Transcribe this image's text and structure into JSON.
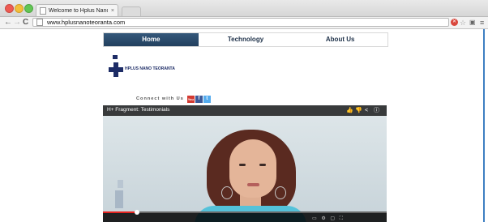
{
  "browser": {
    "tab_title": "Welcome to Hplus Nano Teo",
    "tab_close": "×",
    "url": "www.hplusnanoteoranta.com",
    "nav_back": "←",
    "nav_forward": "→",
    "nav_reload": "C"
  },
  "site": {
    "nav": [
      "Home",
      "Technology",
      "About Us"
    ],
    "logo_text": "HPLUS NANO TEORANTA",
    "connect_label": "Connect with Us",
    "social": {
      "youtube": "You",
      "facebook": "f",
      "twitter": "t"
    }
  },
  "video": {
    "title": "H+ Fragment: Testimonials",
    "progress_fraction": 0.12
  }
}
